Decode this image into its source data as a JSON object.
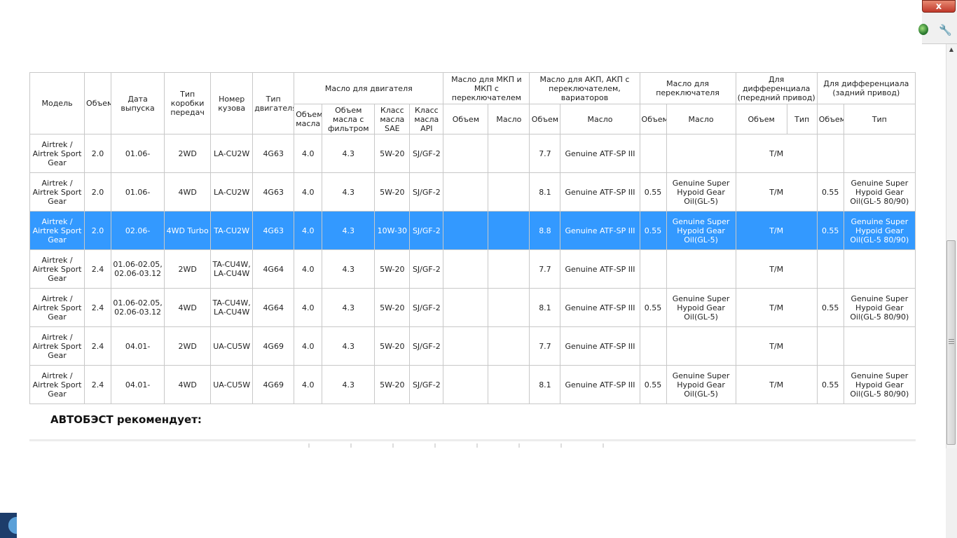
{
  "window": {
    "close_label": "x"
  },
  "icons": {
    "globe": "globe-icon",
    "wrench": "wrench-icon",
    "wrench_glyph": "🔧"
  },
  "table": {
    "headers": {
      "model": "Модель",
      "volume": "Объем",
      "release_date": "Дата выпуска",
      "gearbox_type": "Тип коробки передач",
      "body_number": "Номер кузова",
      "engine_type": "Тип двигателя",
      "engine_oil": "Масло для двигателя",
      "manual_oil": "Масло для МКП и МКП с переключателем",
      "auto_oil": "Масло для АКП, АКП с переключателем, вариаторов",
      "transfer_oil": "Масло для переключателя",
      "front_diff": "Для дифференциала (передний привод)",
      "rear_diff": "Для дифференциала (задний привод)",
      "eo_volume": "Объем масла",
      "eo_volume_filter": "Объем масла с фильтром",
      "eo_sae": "Класс масла SAE",
      "eo_api": "Класс масла API",
      "sub_volume": "Объем",
      "sub_oil": "Масло",
      "sub_type": "Тип"
    },
    "rows": [
      {
        "model": "Airtrek / Airtrek Sport Gear",
        "vol": "2.0",
        "date": "01.06-",
        "gear": "2WD",
        "body": "LA-CU2W",
        "engine": "4G63",
        "eo_vol": "4.0",
        "eo_vol_f": "4.3",
        "sae": "5W-20",
        "api": "SJ/GF-2",
        "mt_vol": "",
        "mt_oil": "",
        "at_vol": "7.7",
        "at_oil": "Genuine ATF-SP III",
        "tr_vol": "",
        "tr_oil": "",
        "fd": "T/M",
        "rd_vol": "",
        "rd_type": ""
      },
      {
        "model": "Airtrek / Airtrek Sport Gear",
        "vol": "2.0",
        "date": "01.06-",
        "gear": "4WD",
        "body": "LA-CU2W",
        "engine": "4G63",
        "eo_vol": "4.0",
        "eo_vol_f": "4.3",
        "sae": "5W-20",
        "api": "SJ/GF-2",
        "mt_vol": "",
        "mt_oil": "",
        "at_vol": "8.1",
        "at_oil": "Genuine ATF-SP III",
        "tr_vol": "0.55",
        "tr_oil": "Genuine Super Hypoid Gear Oil(GL-5)",
        "fd": "T/M",
        "rd_vol": "0.55",
        "rd_type": "Genuine Super Hypoid Gear Oil(GL-5 80/90)"
      },
      {
        "model": "Airtrek / Airtrek Sport Gear",
        "vol": "2.0",
        "date": "02.06-",
        "gear": "4WD Turbo",
        "body": "TA-CU2W",
        "engine": "4G63",
        "eo_vol": "4.0",
        "eo_vol_f": "4.3",
        "sae": "10W-30",
        "api": "SJ/GF-2",
        "mt_vol": "",
        "mt_oil": "",
        "at_vol": "8.8",
        "at_oil": "Genuine ATF-SP III",
        "tr_vol": "0.55",
        "tr_oil": "Genuine Super Hypoid Gear Oil(GL-5)",
        "fd": "T/M",
        "rd_vol": "0.55",
        "rd_type": "Genuine Super Hypoid Gear Oil(GL-5 80/90)"
      },
      {
        "model": "Airtrek / Airtrek Sport Gear",
        "vol": "2.4",
        "date": "01.06-02.05, 02.06-03.12",
        "gear": "2WD",
        "body": "TA-CU4W, LA-CU4W",
        "engine": "4G64",
        "eo_vol": "4.0",
        "eo_vol_f": "4.3",
        "sae": "5W-20",
        "api": "SJ/GF-2",
        "mt_vol": "",
        "mt_oil": "",
        "at_vol": "7.7",
        "at_oil": "Genuine ATF-SP III",
        "tr_vol": "",
        "tr_oil": "",
        "fd": "T/M",
        "rd_vol": "",
        "rd_type": ""
      },
      {
        "model": "Airtrek / Airtrek Sport Gear",
        "vol": "2.4",
        "date": "01.06-02.05, 02.06-03.12",
        "gear": "4WD",
        "body": "TA-CU4W, LA-CU4W",
        "engine": "4G64",
        "eo_vol": "4.0",
        "eo_vol_f": "4.3",
        "sae": "5W-20",
        "api": "SJ/GF-2",
        "mt_vol": "",
        "mt_oil": "",
        "at_vol": "8.1",
        "at_oil": "Genuine ATF-SP III",
        "tr_vol": "0.55",
        "tr_oil": "Genuine Super Hypoid Gear Oil(GL-5)",
        "fd": "T/M",
        "rd_vol": "0.55",
        "rd_type": "Genuine Super Hypoid Gear Oil(GL-5 80/90)"
      },
      {
        "model": "Airtrek / Airtrek Sport Gear",
        "vol": "2.4",
        "date": "04.01-",
        "gear": "2WD",
        "body": "UA-CU5W",
        "engine": "4G69",
        "eo_vol": "4.0",
        "eo_vol_f": "4.3",
        "sae": "5W-20",
        "api": "SJ/GF-2",
        "mt_vol": "",
        "mt_oil": "",
        "at_vol": "7.7",
        "at_oil": "Genuine ATF-SP III",
        "tr_vol": "",
        "tr_oil": "",
        "fd": "T/M",
        "rd_vol": "",
        "rd_type": ""
      },
      {
        "model": "Airtrek / Airtrek Sport Gear",
        "vol": "2.4",
        "date": "04.01-",
        "gear": "4WD",
        "body": "UA-CU5W",
        "engine": "4G69",
        "eo_vol": "4.0",
        "eo_vol_f": "4.3",
        "sae": "5W-20",
        "api": "SJ/GF-2",
        "mt_vol": "",
        "mt_oil": "",
        "at_vol": "8.1",
        "at_oil": "Genuine ATF-SP III",
        "tr_vol": "0.55",
        "tr_oil": "Genuine Super Hypoid Gear Oil(GL-5)",
        "fd": "T/M",
        "rd_vol": "0.55",
        "rd_type": "Genuine Super Hypoid Gear Oil(GL-5 80/90)"
      }
    ],
    "selected_row": 2
  },
  "recommend": {
    "title": "АВТОБЭСТ рекомендует:"
  },
  "colors": {
    "selection": "#3399ff",
    "border": "#c8c8c8"
  }
}
